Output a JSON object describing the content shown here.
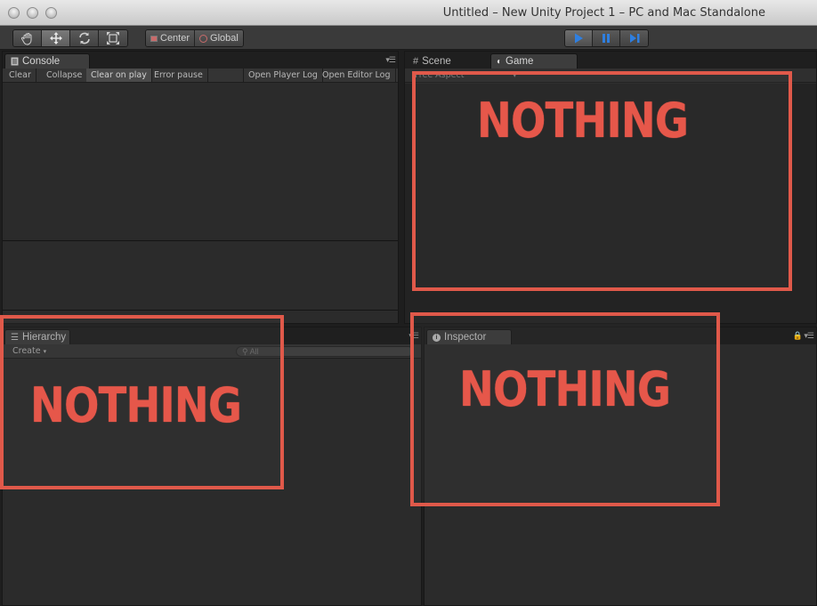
{
  "window": {
    "title": "Untitled – New Unity Project 1 – PC and Mac Standalone"
  },
  "toolbar": {
    "tools": [
      {
        "icon": "hand-icon"
      },
      {
        "icon": "move-icon"
      },
      {
        "icon": "rotate-icon"
      },
      {
        "icon": "scale-icon"
      }
    ],
    "pivot_label": "Center",
    "space_label": "Global"
  },
  "console": {
    "tab_label": "Console",
    "buttons": {
      "clear": "Clear",
      "collapse": "Collapse",
      "clear_on_play": "Clear on play",
      "error_pause": "Error pause",
      "open_player_log": "Open Player Log",
      "open_editor_log": "Open Editor Log"
    }
  },
  "scene": {
    "tab_label": "Scene"
  },
  "game": {
    "tab_label": "Game",
    "aspect_label": "Free Aspect"
  },
  "hierarchy": {
    "tab_label": "Hierarchy",
    "create_label": "Create",
    "search_placeholder": "All"
  },
  "inspector": {
    "tab_label": "Inspector"
  },
  "annotations": {
    "color": "#e0594a",
    "game_label": "NOTHING",
    "hierarchy_label": "NOTHING",
    "inspector_label": "NOTHING"
  }
}
